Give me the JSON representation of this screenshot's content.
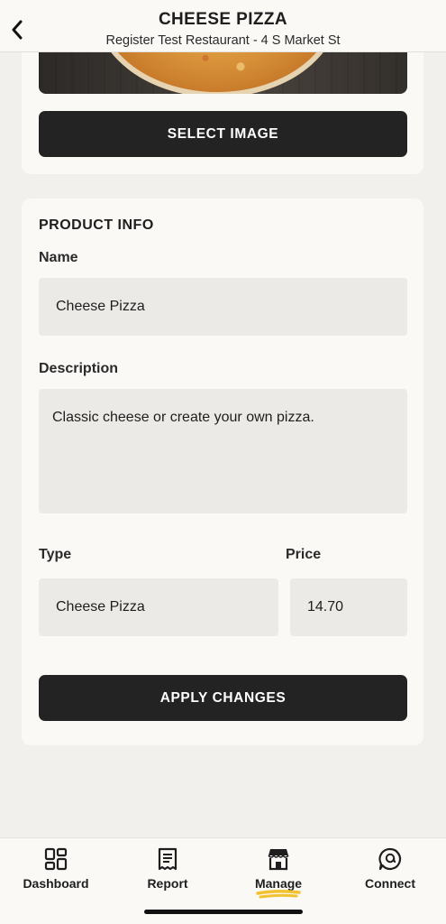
{
  "header": {
    "title": "CHEESE PIZZA",
    "subtitle": "Register Test Restaurant - 4 S Market St",
    "back_icon": "chevron-left-icon"
  },
  "image_section": {
    "select_image_label": "SELECT IMAGE"
  },
  "product_info": {
    "section_title": "PRODUCT INFO",
    "name_label": "Name",
    "name_value": "Cheese Pizza",
    "description_label": "Description",
    "description_value": "Classic cheese or create your own pizza.",
    "type_label": "Type",
    "type_value": "Cheese Pizza",
    "price_label": "Price",
    "price_value": "14.70",
    "apply_label": "APPLY CHANGES"
  },
  "tabbar": {
    "tabs": [
      {
        "label": "Dashboard",
        "icon": "dashboard-icon"
      },
      {
        "label": "Report",
        "icon": "receipt-icon"
      },
      {
        "label": "Manage",
        "icon": "storefront-icon"
      },
      {
        "label": "Connect",
        "icon": "chat-icon"
      }
    ],
    "active_tab": "Manage",
    "accent_color": "#f2c230"
  }
}
